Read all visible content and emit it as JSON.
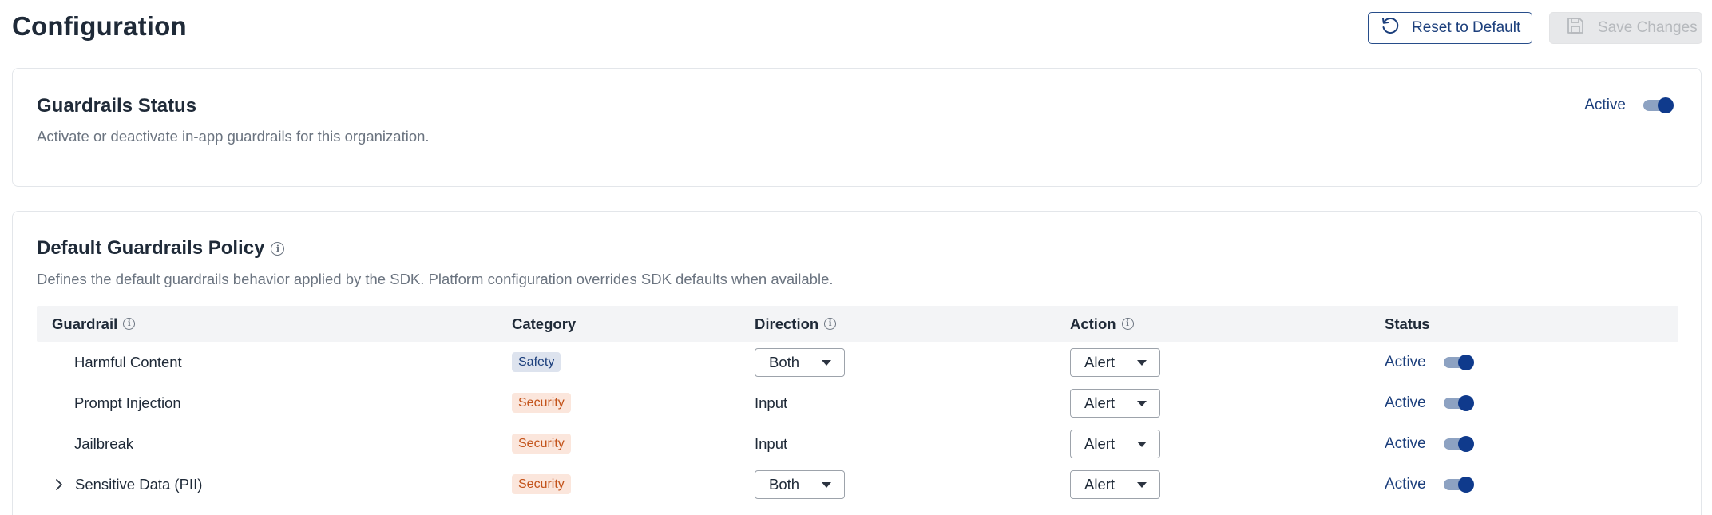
{
  "page": {
    "title": "Configuration"
  },
  "toolbar": {
    "reset_label": "Reset to Default",
    "save_label": "Save Changes"
  },
  "guardrails_status": {
    "title": "Guardrails Status",
    "description": "Activate or deactivate in-app guardrails for this organization.",
    "status_label": "Active",
    "enabled": true
  },
  "policy": {
    "title": "Default Guardrails Policy",
    "description": "Defines the default guardrails behavior applied by the SDK. Platform configuration overrides SDK defaults when available.",
    "columns": {
      "guardrail": "Guardrail",
      "category": "Category",
      "direction": "Direction",
      "action": "Action",
      "status": "Status"
    },
    "rows": [
      {
        "name": "Harmful Content",
        "category": "Safety",
        "direction": "Both",
        "direction_is_select": true,
        "action": "Alert",
        "status": "Active",
        "expandable": false
      },
      {
        "name": "Prompt Injection",
        "category": "Security",
        "direction": "Input",
        "direction_is_select": false,
        "action": "Alert",
        "status": "Active",
        "expandable": false
      },
      {
        "name": "Jailbreak",
        "category": "Security",
        "direction": "Input",
        "direction_is_select": false,
        "action": "Alert",
        "status": "Active",
        "expandable": false
      },
      {
        "name": "Sensitive Data (PII)",
        "category": "Security",
        "direction": "Both",
        "direction_is_select": true,
        "action": "Alert",
        "status": "Active",
        "expandable": true
      }
    ]
  },
  "icons": {
    "reset": "reset-icon",
    "save": "save-icon",
    "info": "info-icon",
    "expand": "chevron-right-icon",
    "dropdown": "caret-down-icon"
  },
  "colors": {
    "primary": "#0f3a8c",
    "link": "#1c3f7c",
    "safety_bg": "#dde3ee",
    "security_bg": "#fbe6dc",
    "security_text": "#c3531a"
  }
}
